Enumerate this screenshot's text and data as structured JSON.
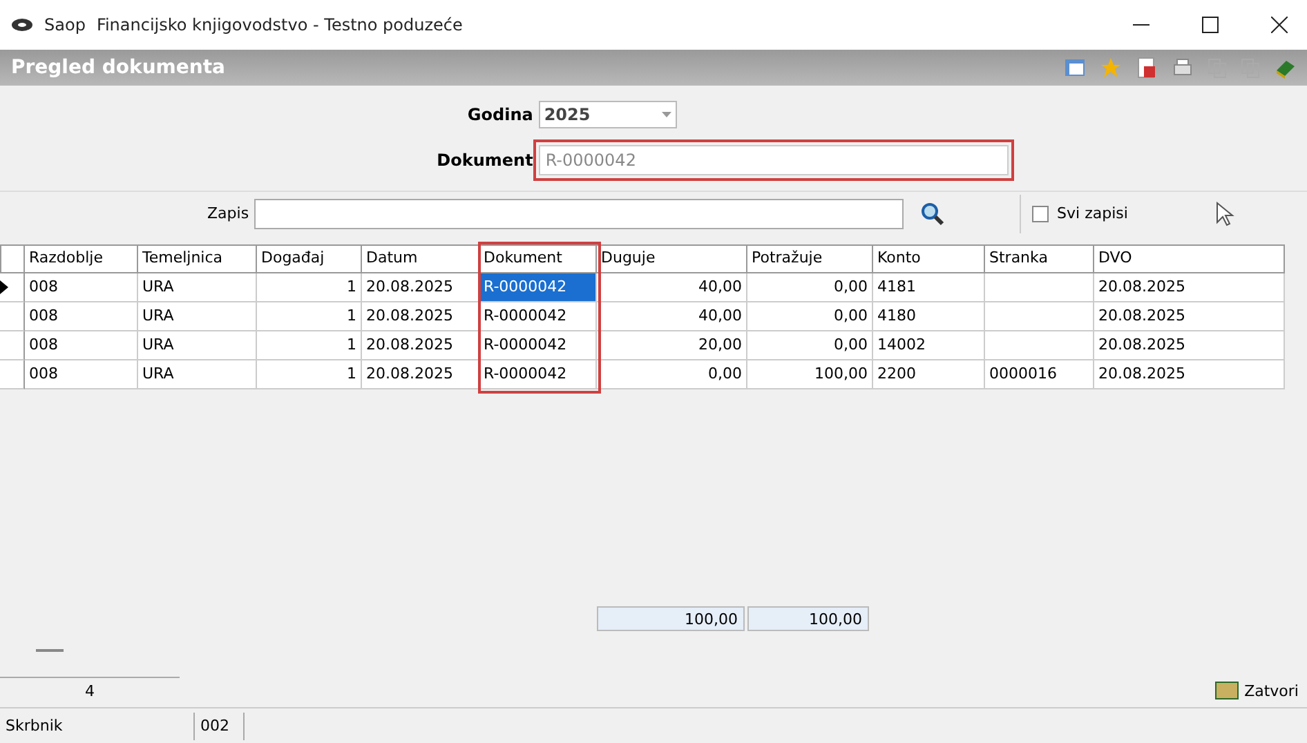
{
  "window": {
    "app": "Saop",
    "title": "Financijsko knjigovodstvo - Testno poduzeće"
  },
  "header": {
    "title": "Pregled dokumenta"
  },
  "form": {
    "year_label": "Godina",
    "year_value": "2025",
    "document_label": "Dokument",
    "document_value": "R-0000042"
  },
  "search": {
    "label": "Zapis",
    "all_records": {
      "label": "Svi zapisi",
      "checked": false
    }
  },
  "table": {
    "columns": [
      "Razdoblje",
      "Temeljnica",
      "Događaj",
      "Datum",
      "Dokument",
      "Duguje",
      "Potražuje",
      "Konto",
      "Stranka",
      "DVO"
    ],
    "rows": [
      {
        "selected": true,
        "cells": [
          "008",
          "URA",
          "1",
          "20.08.2025",
          "R-0000042",
          "40,00",
          "0,00",
          "4181",
          "",
          "20.08.2025"
        ]
      },
      {
        "selected": false,
        "cells": [
          "008",
          "URA",
          "1",
          "20.08.2025",
          "R-0000042",
          "40,00",
          "0,00",
          "4180",
          "",
          "20.08.2025"
        ]
      },
      {
        "selected": false,
        "cells": [
          "008",
          "URA",
          "1",
          "20.08.2025",
          "R-0000042",
          "20,00",
          "0,00",
          "14002",
          "",
          "20.08.2025"
        ]
      },
      {
        "selected": false,
        "cells": [
          "008",
          "URA",
          "1",
          "20.08.2025",
          "R-0000042",
          "0,00",
          "100,00",
          "2200",
          "0000016",
          "20.08.2025"
        ]
      }
    ],
    "totals": [
      "100,00",
      "100,00"
    ]
  },
  "record_count": "4",
  "close_button": "Zatvori",
  "status_bar": {
    "label": "Skrbnik",
    "value": "002"
  }
}
